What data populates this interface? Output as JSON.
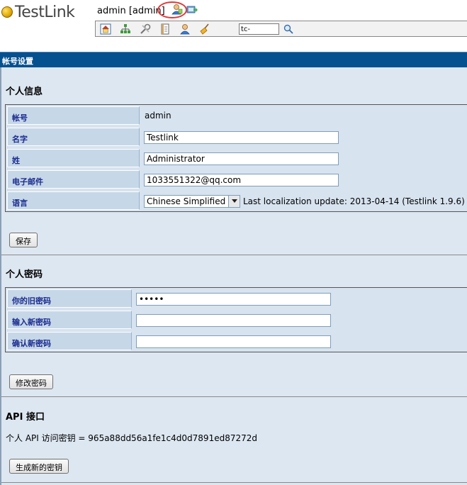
{
  "app": {
    "logo_text": "TestLink"
  },
  "header": {
    "user_label": "admin [admin]",
    "icons": [
      "user-profile-icon",
      "logout-icon"
    ],
    "toolbar": {
      "icons": [
        "home-icon",
        "tree-icon",
        "tools-icon",
        "document-icon",
        "user-icon",
        "broom-icon"
      ],
      "search_value": "tc-"
    }
  },
  "page_title": "帐号设置",
  "personal_info": {
    "title": "个人信息",
    "fields": {
      "account_label": "帐号",
      "account_value": "admin",
      "firstname_label": "名字",
      "firstname_value": "Testlink",
      "lastname_label": "姓",
      "lastname_value": "Administrator",
      "email_label": "电子邮件",
      "email_value": "1033551322@qq.com",
      "language_label": "语言",
      "language_value": "Chinese Simplified",
      "localization_note": "Last localization update: 2013-04-14 (Testlink 1.9.6)"
    },
    "save_button": "保存"
  },
  "personal_password": {
    "title": "个人密码",
    "old_password_label": "你的旧密码",
    "old_password_value": "•••••",
    "new_password_label": "输入新密码",
    "confirm_password_label": "确认新密码",
    "change_button": "修改密码"
  },
  "api": {
    "title": "API 接口",
    "key_line": "个人 API 访问密钥 = 965a88dd56a1fe1c4d0d7891ed87272d",
    "generate_button": "生成新的密钥"
  },
  "colors": {
    "title_bar": "#05508f",
    "panel_bg": "#dde7f1",
    "label_bg": "#c6d7e8",
    "label_text": "#1a2b8f",
    "highlight_circle": "#e03a3a"
  }
}
